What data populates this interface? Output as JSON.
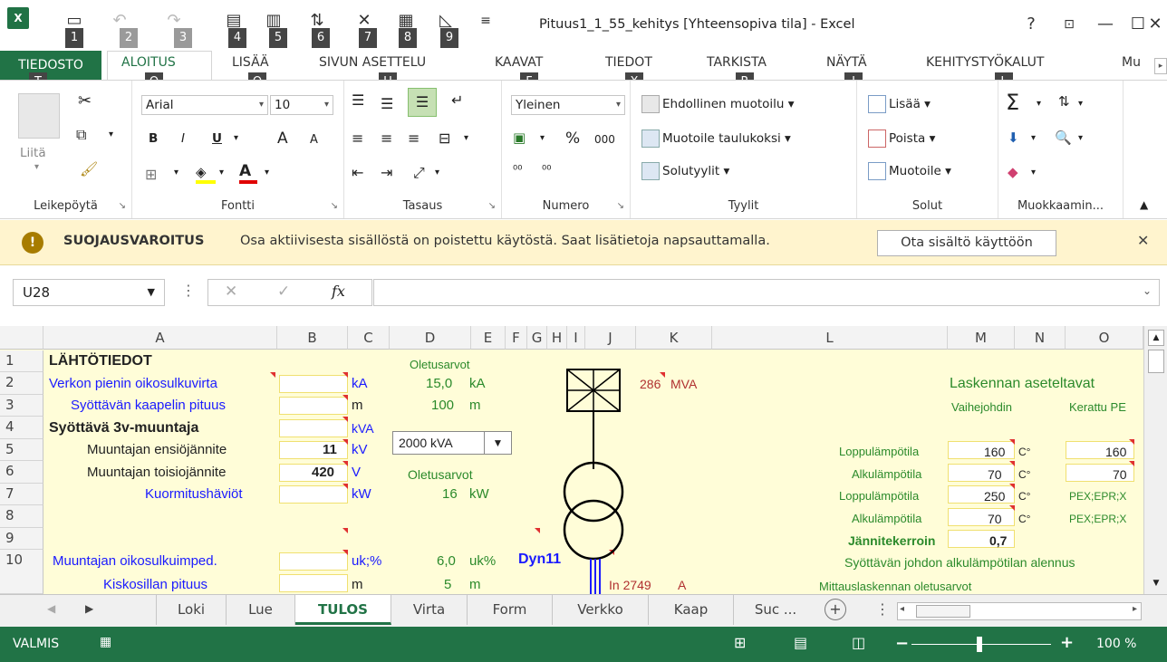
{
  "window": {
    "title": "Pituus1_1_55_kehitys  [Yhteensopiva tila] - Excel",
    "help": "?",
    "keytips_qat": [
      "1",
      "2",
      "3",
      "4",
      "5",
      "6",
      "7",
      "8",
      "9"
    ]
  },
  "tabs": {
    "file": "TIEDOSTO",
    "items": [
      "ALOITUS",
      "LISÄÄ",
      "SIVUN ASETTELU",
      "KAAVAT",
      "TIEDOT",
      "TARKISTA",
      "NÄYTÄ",
      "KEHITYSTYÖKALUT",
      "Mu"
    ],
    "keytips": [
      "T",
      "O",
      "Q",
      "U",
      "F",
      "X",
      "R",
      "I",
      "L"
    ]
  },
  "ribbon": {
    "clipboard": {
      "label": "Leikepöytä",
      "paste": "Liitä"
    },
    "font": {
      "label": "Fontti",
      "name": "Arial",
      "size": "10",
      "bold": "B",
      "italic": "I",
      "underline": "U",
      "grow": "A",
      "shrink": "A",
      "color": "A"
    },
    "alignment": {
      "label": "Tasaus"
    },
    "number": {
      "label": "Numero",
      "format": "Yleinen",
      "percent": "%",
      "thousands": "000"
    },
    "styles": {
      "label": "Tyylit",
      "conditional": "Ehdollinen muotoilu",
      "table": "Muotoile taulukoksi",
      "cell": "Solutyylit"
    },
    "cells": {
      "label": "Solut",
      "insert": "Lisää",
      "delete": "Poista",
      "format": "Muotoile"
    },
    "editing": {
      "label": "Muokkaamin..."
    }
  },
  "security": {
    "title": "SUOJAUSVAROITUS",
    "message": "Osa aktiivisesta sisällöstä on poistettu käytöstä. Saat lisätietoja napsauttamalla.",
    "button": "Ota sisältö käyttöön"
  },
  "formula": {
    "namebox": "U28",
    "fx": "fx",
    "value": ""
  },
  "columns": [
    "A",
    "B",
    "C",
    "D",
    "E",
    "F",
    "G",
    "H",
    "I",
    "J",
    "K",
    "L",
    "M",
    "N",
    "O"
  ],
  "rows": [
    "1",
    "2",
    "3",
    "4",
    "5",
    "6",
    "7",
    "8",
    "9",
    "10"
  ],
  "cells": {
    "a1": "LÄHTÖTIEDOT",
    "d1": "Oletusarvot",
    "a2": "Verkon pienin oikosulkuvirta",
    "c2": "kA",
    "d2": "15,0",
    "e2": "kA",
    "j2": "286",
    "k2": "MVA",
    "l2": "Laskennan aseteltavat",
    "a3": "Syöttävän kaapelin pituus",
    "c3": "m",
    "d3": "100",
    "e3": "m",
    "m3": "Vaihejohdin",
    "o3": "Kerattu PE",
    "a4": "Syöttävä 3v-muuntaja",
    "c4": "kVA",
    "dropdown": "2000 kVA",
    "l4": "Loppulämpötila",
    "m4": "160",
    "n4": "C°",
    "o4": "160",
    "a5": "Muuntajan ensiöjännite",
    "b5": "11",
    "c5": "kV",
    "l5": "Alkulämpötila",
    "m5": "70",
    "n5": "C°",
    "o5": "70",
    "a6": "Muuntajan toisiojännite",
    "b6": "420",
    "c6": "V",
    "d6": "Oletusarvot",
    "l6": "Loppulämpötila",
    "m6": "250",
    "n6": "C°",
    "o6": "PEX;EPR;X",
    "a7": "Kuormitushäviöt",
    "c7": "kW",
    "d7": "16",
    "e7": "kW",
    "l7": "Alkulämpötila",
    "m7": "70",
    "n7": "C°",
    "o7": "PEX;EPR;X",
    "l8": "Jännitekerroin",
    "m8": "0,7",
    "a9": "Muuntajan oikosulkuimped.",
    "c9": "uk;%",
    "d9": "6,0",
    "e9": "uk%",
    "f9": "Dyn11",
    "l9": "Syöttävän johdon alkulämpötilan alennus",
    "a10": "Kiskosillan pituus",
    "c10": "m",
    "d10": "5",
    "e10": "m",
    "j10": "In",
    "j10v": "2749",
    "k10": "A",
    "l10": "Mittauslaskennan oletusarvot"
  },
  "sheets": [
    "Loki",
    "Lue",
    "TULOS",
    "Virta",
    "Form",
    "Verkko",
    "Kaap",
    "Suc ..."
  ],
  "status": {
    "mode": "VALMIS",
    "zoom": "100 %"
  }
}
